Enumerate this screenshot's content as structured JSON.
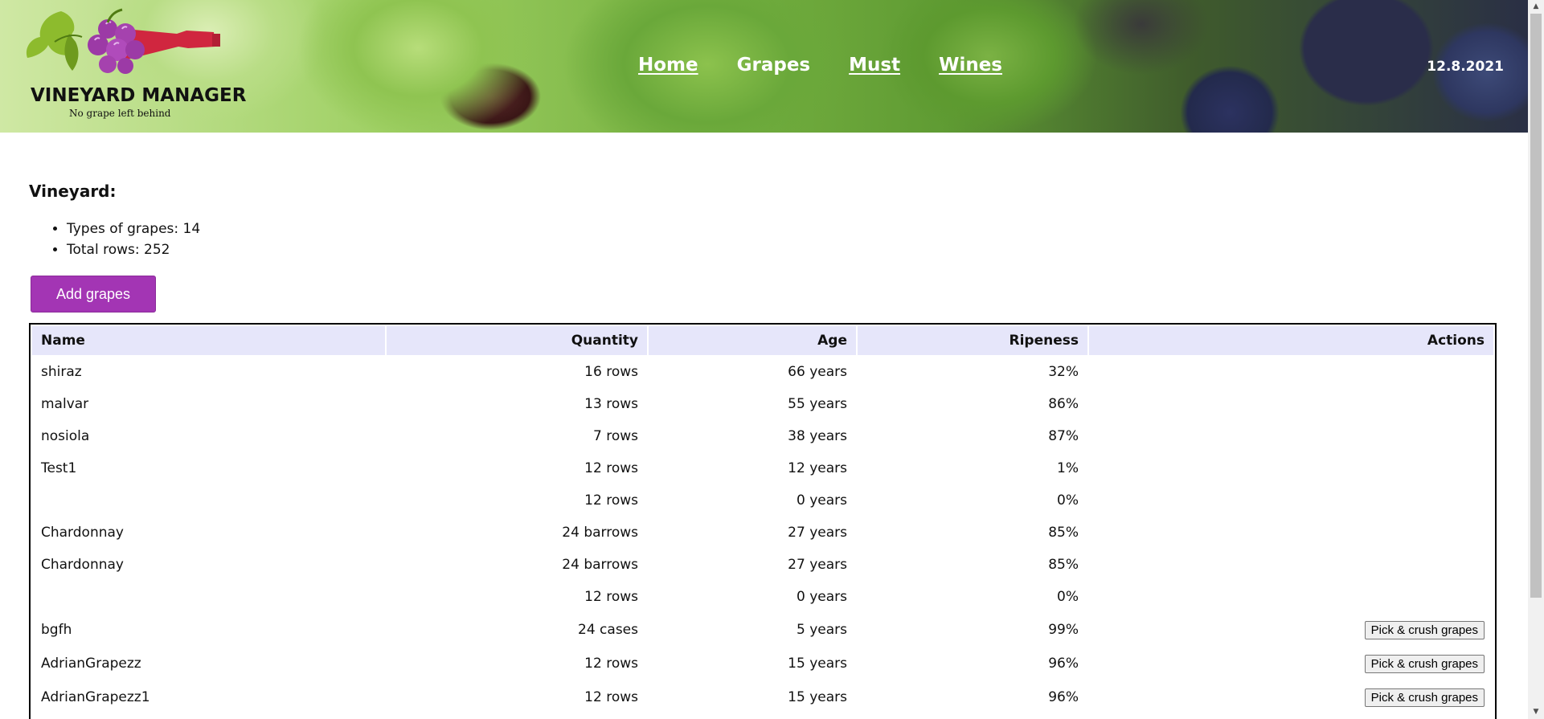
{
  "header": {
    "logo_title": "VINEYARD MANAGER",
    "logo_tagline": "No grape left behind",
    "nav": [
      {
        "label": "Home"
      },
      {
        "label": "Grapes"
      },
      {
        "label": "Must"
      },
      {
        "label": "Wines"
      }
    ],
    "active_nav": "Grapes",
    "date": "12.8.2021"
  },
  "vineyard": {
    "title": "Vineyard:",
    "types_of_grapes": "Types of grapes: 14",
    "total_rows": "Total rows: 252",
    "add_button": "Add grapes"
  },
  "table": {
    "headers": {
      "name": "Name",
      "quantity": "Quantity",
      "age": "Age",
      "ripeness": "Ripeness",
      "actions": "Actions"
    },
    "rows": [
      {
        "name": "shiraz",
        "quantity": "16 rows",
        "age": "66 years",
        "ripeness": "32%",
        "action": ""
      },
      {
        "name": "malvar",
        "quantity": "13 rows",
        "age": "55 years",
        "ripeness": "86%",
        "action": ""
      },
      {
        "name": "nosiola",
        "quantity": "7 rows",
        "age": "38 years",
        "ripeness": "87%",
        "action": ""
      },
      {
        "name": "Test1",
        "quantity": "12 rows",
        "age": "12 years",
        "ripeness": "1%",
        "action": ""
      },
      {
        "name": "",
        "quantity": "12 rows",
        "age": "0 years",
        "ripeness": "0%",
        "action": ""
      },
      {
        "name": "Chardonnay",
        "quantity": "24 barrows",
        "age": "27 years",
        "ripeness": "85%",
        "action": ""
      },
      {
        "name": "Chardonnay",
        "quantity": "24 barrows",
        "age": "27 years",
        "ripeness": "85%",
        "action": ""
      },
      {
        "name": "",
        "quantity": "12 rows",
        "age": "0 years",
        "ripeness": "0%",
        "action": ""
      },
      {
        "name": "bgfh",
        "quantity": "24 cases",
        "age": "5 years",
        "ripeness": "99%",
        "action": "Pick & crush grapes"
      },
      {
        "name": "AdrianGrapezz",
        "quantity": "12 rows",
        "age": "15 years",
        "ripeness": "96%",
        "action": "Pick & crush grapes"
      },
      {
        "name": "AdrianGrapezz1",
        "quantity": "12 rows",
        "age": "15 years",
        "ripeness": "96%",
        "action": "Pick & crush grapes"
      }
    ]
  },
  "icons": {
    "logo": "grape-wine-bottle-logo",
    "scroll_up": "up-arrow-icon",
    "scroll_down": "down-arrow-icon"
  },
  "colors": {
    "accent": "#a335b4",
    "table_header_bg": "#e6e6fa",
    "logo_grape": "#9c3aa6",
    "logo_bottle": "#d0263f",
    "logo_leaf": "#8dbb2d"
  }
}
